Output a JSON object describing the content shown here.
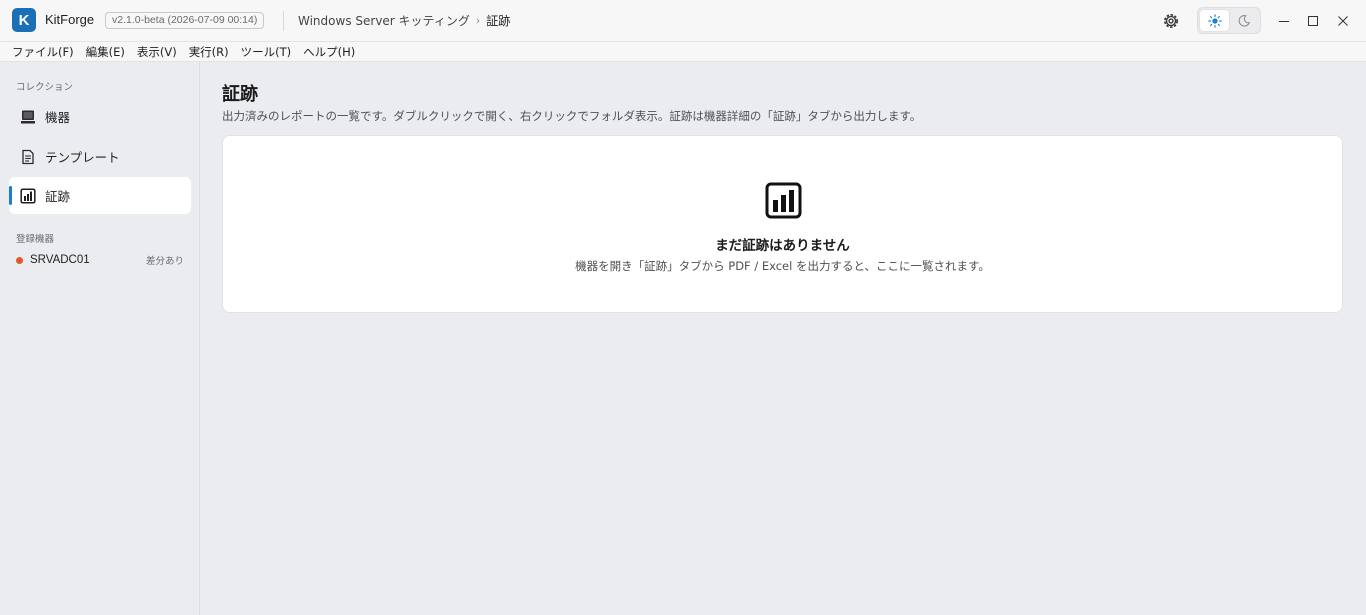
{
  "app": {
    "logo_letter": "K",
    "name": "KitForge",
    "version": "v2.1.0-beta  (2026-07-09 00:14)"
  },
  "breadcrumb": {
    "parent": "Windows Server キッティング",
    "separator": "›",
    "current": "証跡"
  },
  "theme": {
    "selected": "light"
  },
  "menu": {
    "items": [
      "ファイル(F)",
      "編集(E)",
      "表示(V)",
      "実行(R)",
      "ツール(T)",
      "ヘルプ(H)"
    ]
  },
  "sidebar": {
    "collection_heading": "コレクション",
    "nav": [
      {
        "label": "機器",
        "icon": "device-icon"
      },
      {
        "label": "テンプレート",
        "icon": "document-icon"
      },
      {
        "label": "証跡",
        "icon": "chart-icon",
        "active": true
      }
    ],
    "devices_heading": "登録機器",
    "devices": [
      {
        "name": "SRVADC01",
        "badge": "差分あり",
        "status_color": "#e2572b"
      }
    ]
  },
  "main": {
    "title": "証跡",
    "description": "出力済みのレポートの一覧です。ダブルクリックで開く、右クリックでフォルダ表示。証跡は機器詳細の「証跡」タブから出力します。",
    "empty": {
      "icon": "chart-icon",
      "title": "まだ証跡はありません",
      "subtitle": "機器を開き「証跡」タブから PDF / Excel を出力すると、ここに一覧されます。"
    }
  },
  "colors": {
    "accent": "#1a7fd0",
    "logo": "#1a6fb5",
    "status_diff": "#e2572b"
  }
}
